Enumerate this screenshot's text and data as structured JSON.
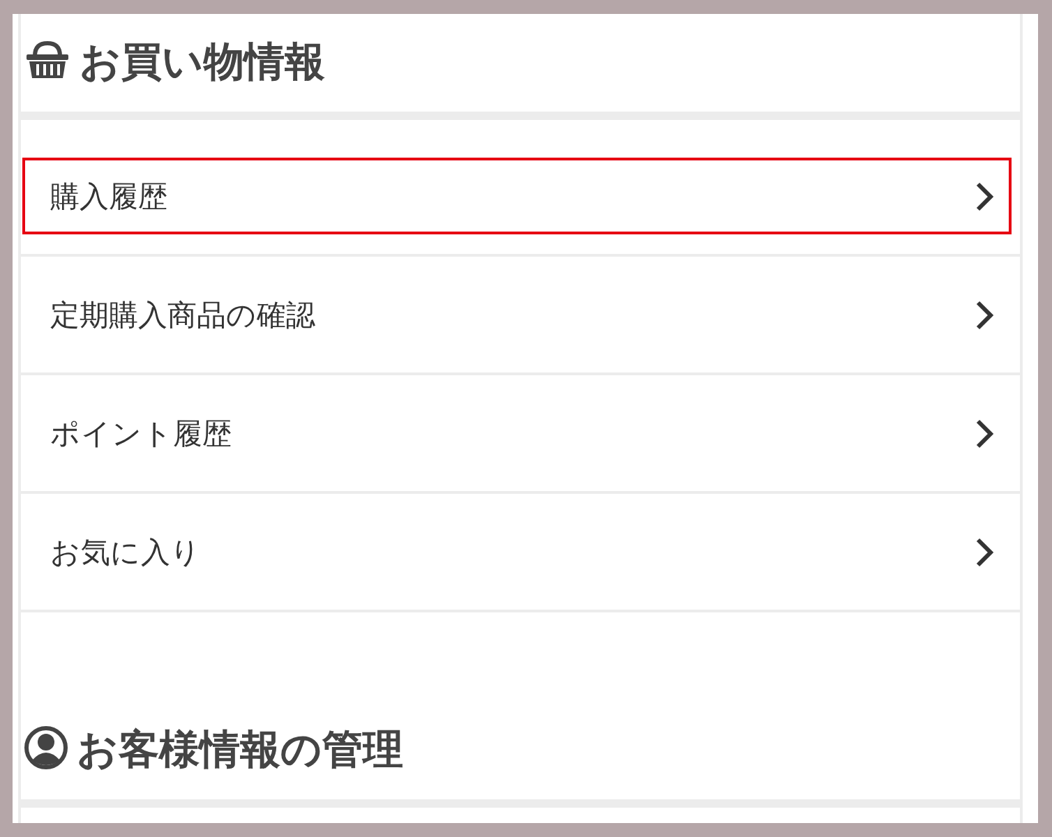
{
  "sections": [
    {
      "title": "お買い物情報",
      "kind": "shopping",
      "items": [
        {
          "label": "購入履歴",
          "highlighted": true
        },
        {
          "label": "定期購入商品の確認",
          "highlighted": false
        },
        {
          "label": "ポイント履歴",
          "highlighted": false
        },
        {
          "label": "お気に入り",
          "highlighted": false
        }
      ]
    },
    {
      "title": "お客様情報の管理",
      "kind": "account"
    }
  ]
}
